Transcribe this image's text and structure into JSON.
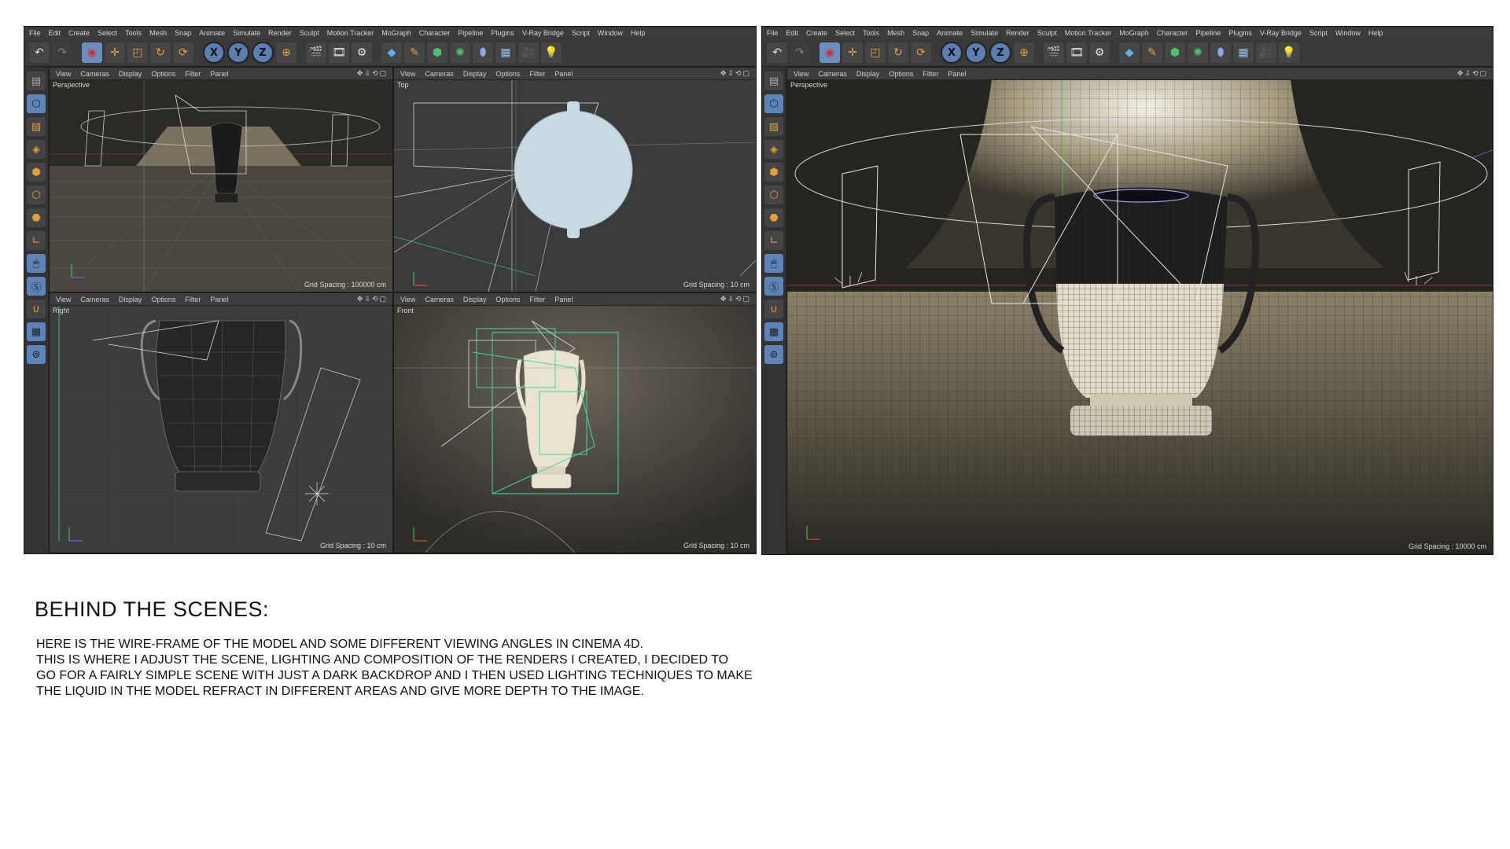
{
  "menu": [
    "File",
    "Edit",
    "Create",
    "Select",
    "Tools",
    "Mesh",
    "Snap",
    "Animate",
    "Simulate",
    "Render",
    "Sculpt",
    "Motion Tracker",
    "MoGraph",
    "Character",
    "Pipeline",
    "Plugins",
    "V-Ray Bridge",
    "Script",
    "Window",
    "Help"
  ],
  "toolbar_icons": [
    "undo-icon",
    "redo-icon",
    "live-select-icon",
    "move-icon",
    "scale-icon",
    "rotate-icon",
    "rotate-alt-icon",
    "x-axis-icon",
    "y-axis-icon",
    "z-axis-icon",
    "coordinate-system-icon",
    "render-view-icon",
    "render-picture-queue-icon",
    "render-settings-icon",
    "cube-primitive-icon",
    "pen-spline-icon",
    "subdivision-icon",
    "array-icon",
    "deformer-icon",
    "floor-icon",
    "camera-icon",
    "light-icon"
  ],
  "axis_labels": [
    "X",
    "Y",
    "Z"
  ],
  "viewport_menu": [
    "View",
    "Cameras",
    "Display",
    "Options",
    "Filter",
    "Panel"
  ],
  "left_app": {
    "viewports": [
      {
        "name": "Perspective",
        "grid": "Grid Spacing : 100000 cm"
      },
      {
        "name": "Top",
        "grid": "Grid Spacing : 10 cm"
      },
      {
        "name": "Right",
        "grid": "Grid Spacing : 10 cm"
      },
      {
        "name": "Front",
        "grid": "Grid Spacing : 10 cm"
      }
    ]
  },
  "right_app": {
    "viewport": {
      "name": "Perspective",
      "grid": "Grid Spacing : 10000 cm"
    }
  },
  "headline": "BEHIND THE SCENES:",
  "body_lines": [
    "HERE IS THE WIRE-FRAME OF THE MODEL AND SOME DIFFERENT VIEWING ANGLES IN CINEMA 4D.",
    "THIS IS WHERE I ADJUST THE SCENE, LIGHTING AND COMPOSITION OF THE RENDERS I CREATED, I DECIDED TO",
    "GO FOR A FAIRLY SIMPLE SCENE WITH JUST A DARK BACKDROP AND I THEN USED LIGHTING TECHNIQUES TO MAKE",
    "THE LIQUID IN THE MODEL REFRACT IN DIFFERENT AREAS AND GIVE MORE DEPTH TO THE IMAGE."
  ],
  "colors": {
    "accent": "#6a8fbf",
    "app_bg": "#2b2b2b",
    "viewport_bg": "#3a3a3a",
    "helper_green": "#3fd9a0"
  }
}
